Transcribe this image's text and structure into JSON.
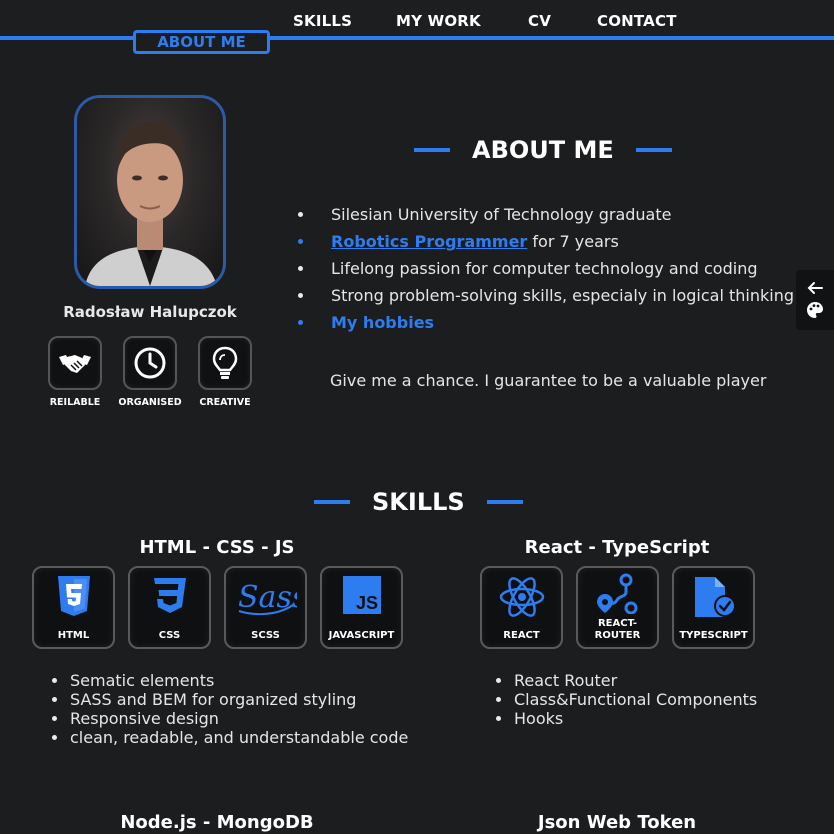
{
  "nav": {
    "items": [
      "SKILLS",
      "MY WORK",
      "CV",
      "CONTACT"
    ],
    "active": "ABOUT ME"
  },
  "profile": {
    "name": "Radosław Halupczok",
    "traits": [
      {
        "label": "REILABLE",
        "icon": "handshake-icon"
      },
      {
        "label": "ORGANISED",
        "icon": "clock-icon"
      },
      {
        "label": "CREATIVE",
        "icon": "lightbulb-icon"
      }
    ]
  },
  "about": {
    "title": "ABOUT ME",
    "items": {
      "uni": "Silesian University of Technology graduate",
      "robotics_link": "Robotics Programmer",
      "robotics_rest": " for 7 years",
      "passion": "Lifelong passion for computer technology and coding",
      "problem": "Strong problem-solving skills, especialy in logical thinking",
      "hobbies_link": "My hobbies"
    },
    "tagline": "Give me a chance. I guarantee to be a valuable player"
  },
  "side_widget": {
    "icons": [
      "arrow-left-icon",
      "palette-icon"
    ]
  },
  "skills": {
    "title": "SKILLS",
    "groups": [
      {
        "title": "HTML - CSS - JS",
        "items": [
          {
            "label": "HTML",
            "icon": "html5-icon"
          },
          {
            "label": "CSS",
            "icon": "css3-icon"
          },
          {
            "label": "SCSS",
            "icon": "sass-icon"
          },
          {
            "label": "JAVASCRIPT",
            "icon": "javascript-icon"
          }
        ],
        "bullets": [
          "Sematic elements",
          "SASS and BEM for organized styling",
          "Responsive design",
          "clean, readable, and understandable code"
        ]
      },
      {
        "title": "React - TypeScript",
        "items": [
          {
            "label": "REACT",
            "icon": "react-icon"
          },
          {
            "label": "REACT-\nROUTER",
            "icon": "react-router-icon"
          },
          {
            "label": "TYPESCRIPT",
            "icon": "typescript-file-icon"
          }
        ],
        "bullets": [
          "React Router",
          "Class&Functional Components",
          "Hooks"
        ]
      },
      {
        "title": "Node.js - MongoDB"
      },
      {
        "title": "Json Web Token"
      }
    ]
  },
  "colors": {
    "accent": "#2e7df0",
    "background": "#1c1d1f",
    "text": "#eaeaea"
  }
}
